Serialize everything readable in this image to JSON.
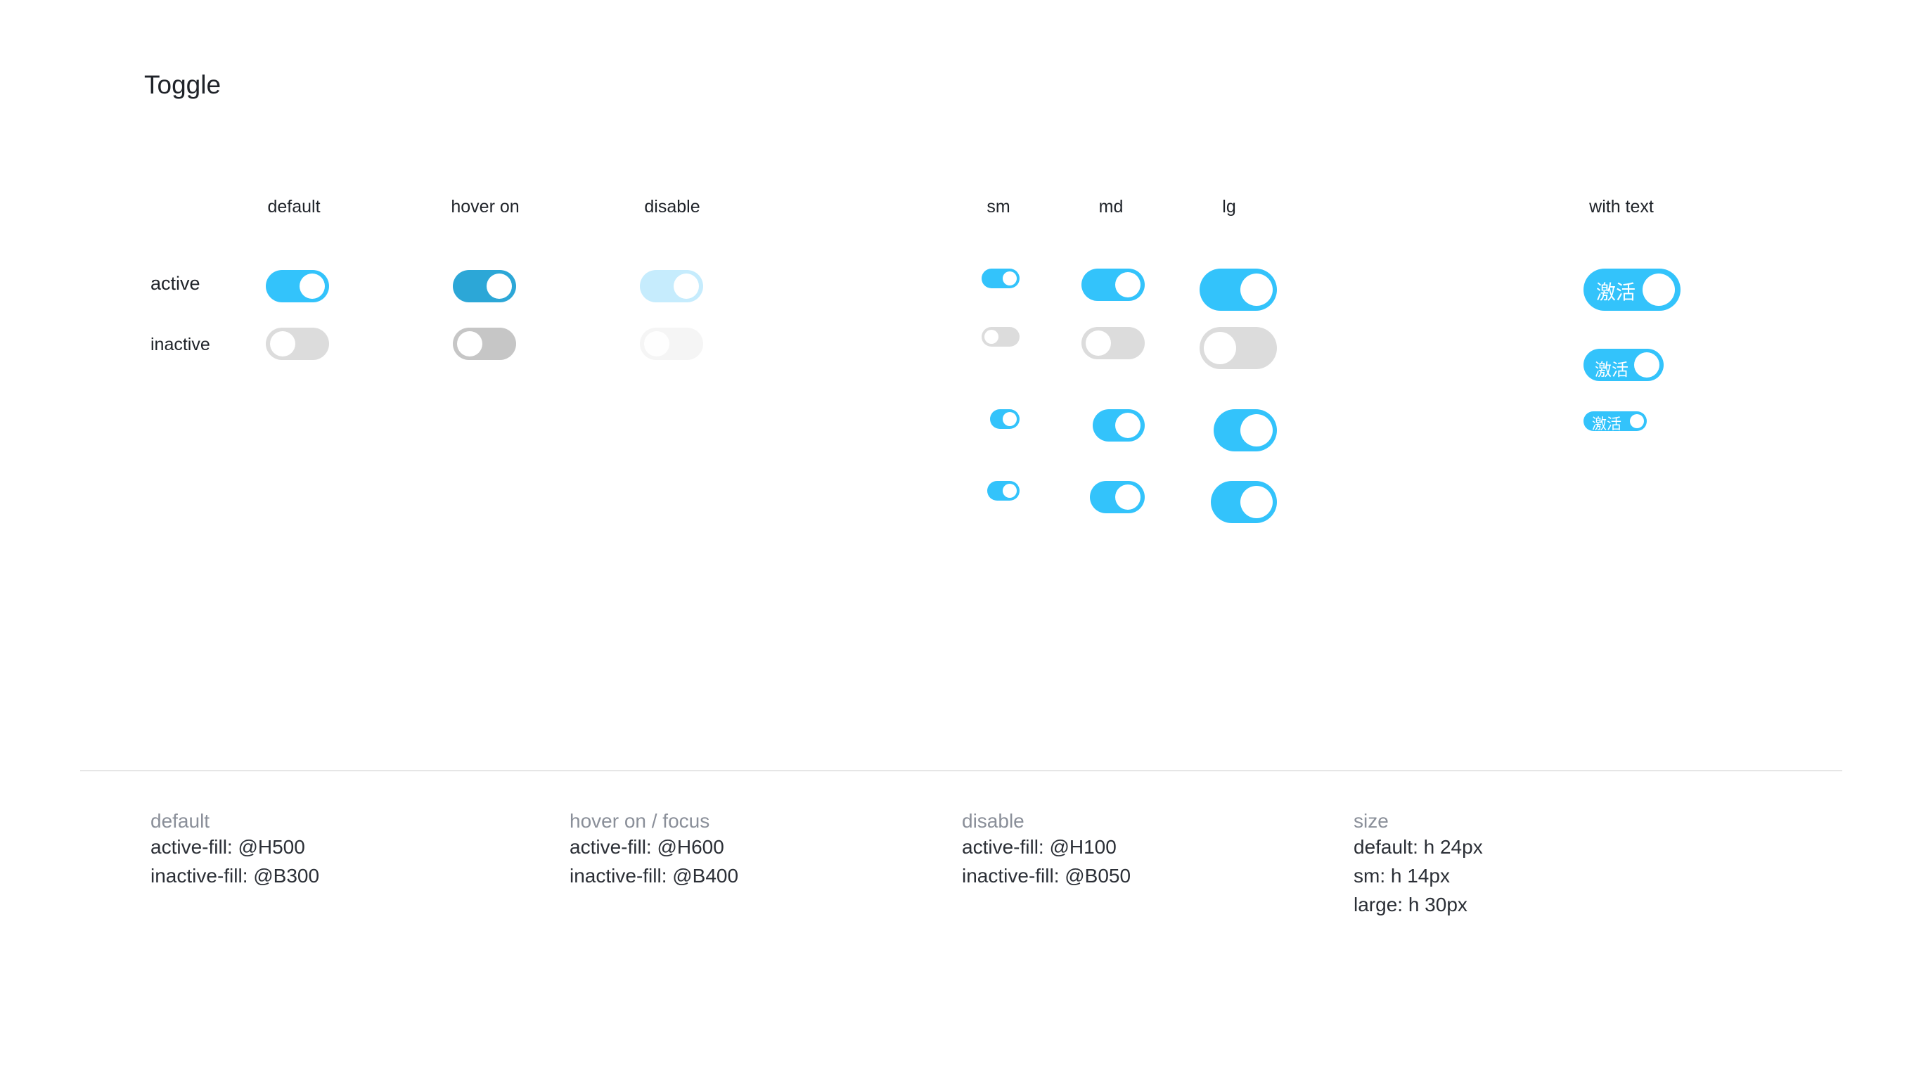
{
  "page": {
    "title": "Toggle"
  },
  "colors": {
    "H500": "#33c3fb",
    "H600": "#2ca7d7",
    "H100": "#c6ecfd",
    "B300": "#dcdcdc",
    "B400": "#c6c6c6",
    "B050": "#f5f5f5",
    "knob": "#ffffff"
  },
  "state_columns": {
    "default": "default",
    "hover_on": "hover on",
    "disable": "disable"
  },
  "size_columns": {
    "sm": "sm",
    "md": "md",
    "lg": "lg"
  },
  "with_text_column": "with text",
  "rows": {
    "active": "active",
    "inactive": "inactive"
  },
  "toggles": {
    "default_active": {
      "state": "on",
      "fill": "H500"
    },
    "default_inactive": {
      "state": "off",
      "fill": "B300"
    },
    "hover_active": {
      "state": "on",
      "fill": "H600"
    },
    "hover_inactive": {
      "state": "off",
      "fill": "B400"
    },
    "disable_active": {
      "state": "on",
      "fill": "H100"
    },
    "disable_inactive": {
      "state": "off",
      "fill": "B050"
    },
    "with_text_label": "激活"
  },
  "notes": [
    {
      "title": "default",
      "lines": [
        "active-fill: @H500",
        "inactive-fill: @B300"
      ]
    },
    {
      "title": "hover on / focus",
      "lines": [
        "active-fill: @H600",
        "inactive-fill: @B400"
      ]
    },
    {
      "title": "disable",
      "lines": [
        "active-fill: @H100",
        "inactive-fill: @B050"
      ]
    },
    {
      "title": "size",
      "lines": [
        "default: h 24px",
        "sm: h 14px",
        "large: h 30px"
      ]
    }
  ]
}
